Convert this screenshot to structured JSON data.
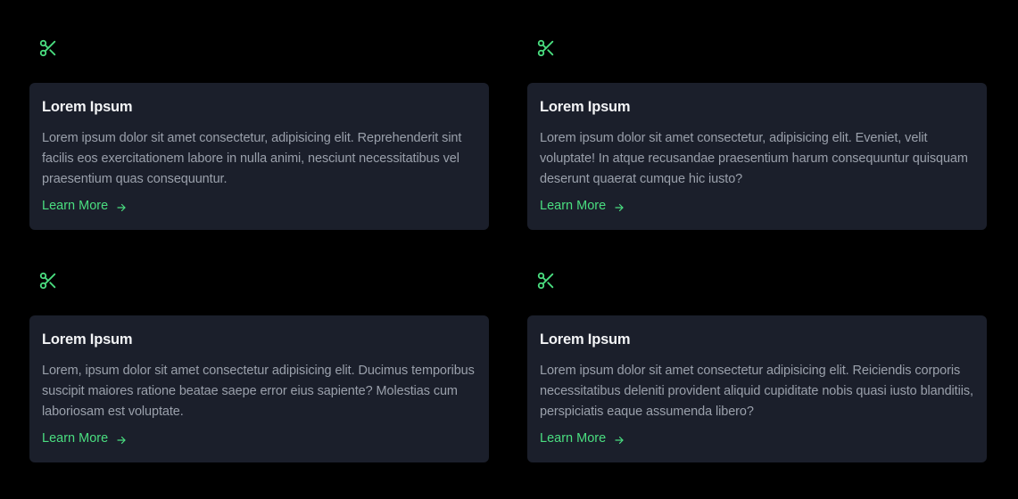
{
  "colors": {
    "background": "#000000",
    "card": "#1b1f2b",
    "accent": "#4ade80",
    "title": "#f3f4f6",
    "body": "#9aa0ab"
  },
  "cards": [
    {
      "icon": "scissors-icon",
      "title": "Lorem Ipsum",
      "body": "Lorem ipsum dolor sit amet consectetur, adipisicing elit. Reprehenderit sint facilis eos exercitationem labore in nulla animi, nesciunt necessitatibus vel praesentium quas consequuntur.",
      "link": "Learn More"
    },
    {
      "icon": "scissors-icon",
      "title": "Lorem Ipsum",
      "body": "Lorem ipsum dolor sit amet consectetur, adipisicing elit. Eveniet, velit voluptate! In atque recusandae praesentium harum consequuntur quisquam deserunt quaerat cumque hic iusto?",
      "link": "Learn More"
    },
    {
      "icon": "scissors-icon",
      "title": "Lorem Ipsum",
      "body": "Lorem, ipsum dolor sit amet consectetur adipisicing elit. Ducimus temporibus suscipit maiores ratione beatae saepe error eius sapiente? Molestias cum laboriosam est voluptate.",
      "link": "Learn More"
    },
    {
      "icon": "scissors-icon",
      "title": "Lorem Ipsum",
      "body": "Lorem ipsum dolor sit amet consectetur adipisicing elit. Reiciendis corporis necessitatibus deleniti provident aliquid cupiditate nobis quasi iusto blanditiis, perspiciatis eaque assumenda libero?",
      "link": "Learn More"
    }
  ]
}
